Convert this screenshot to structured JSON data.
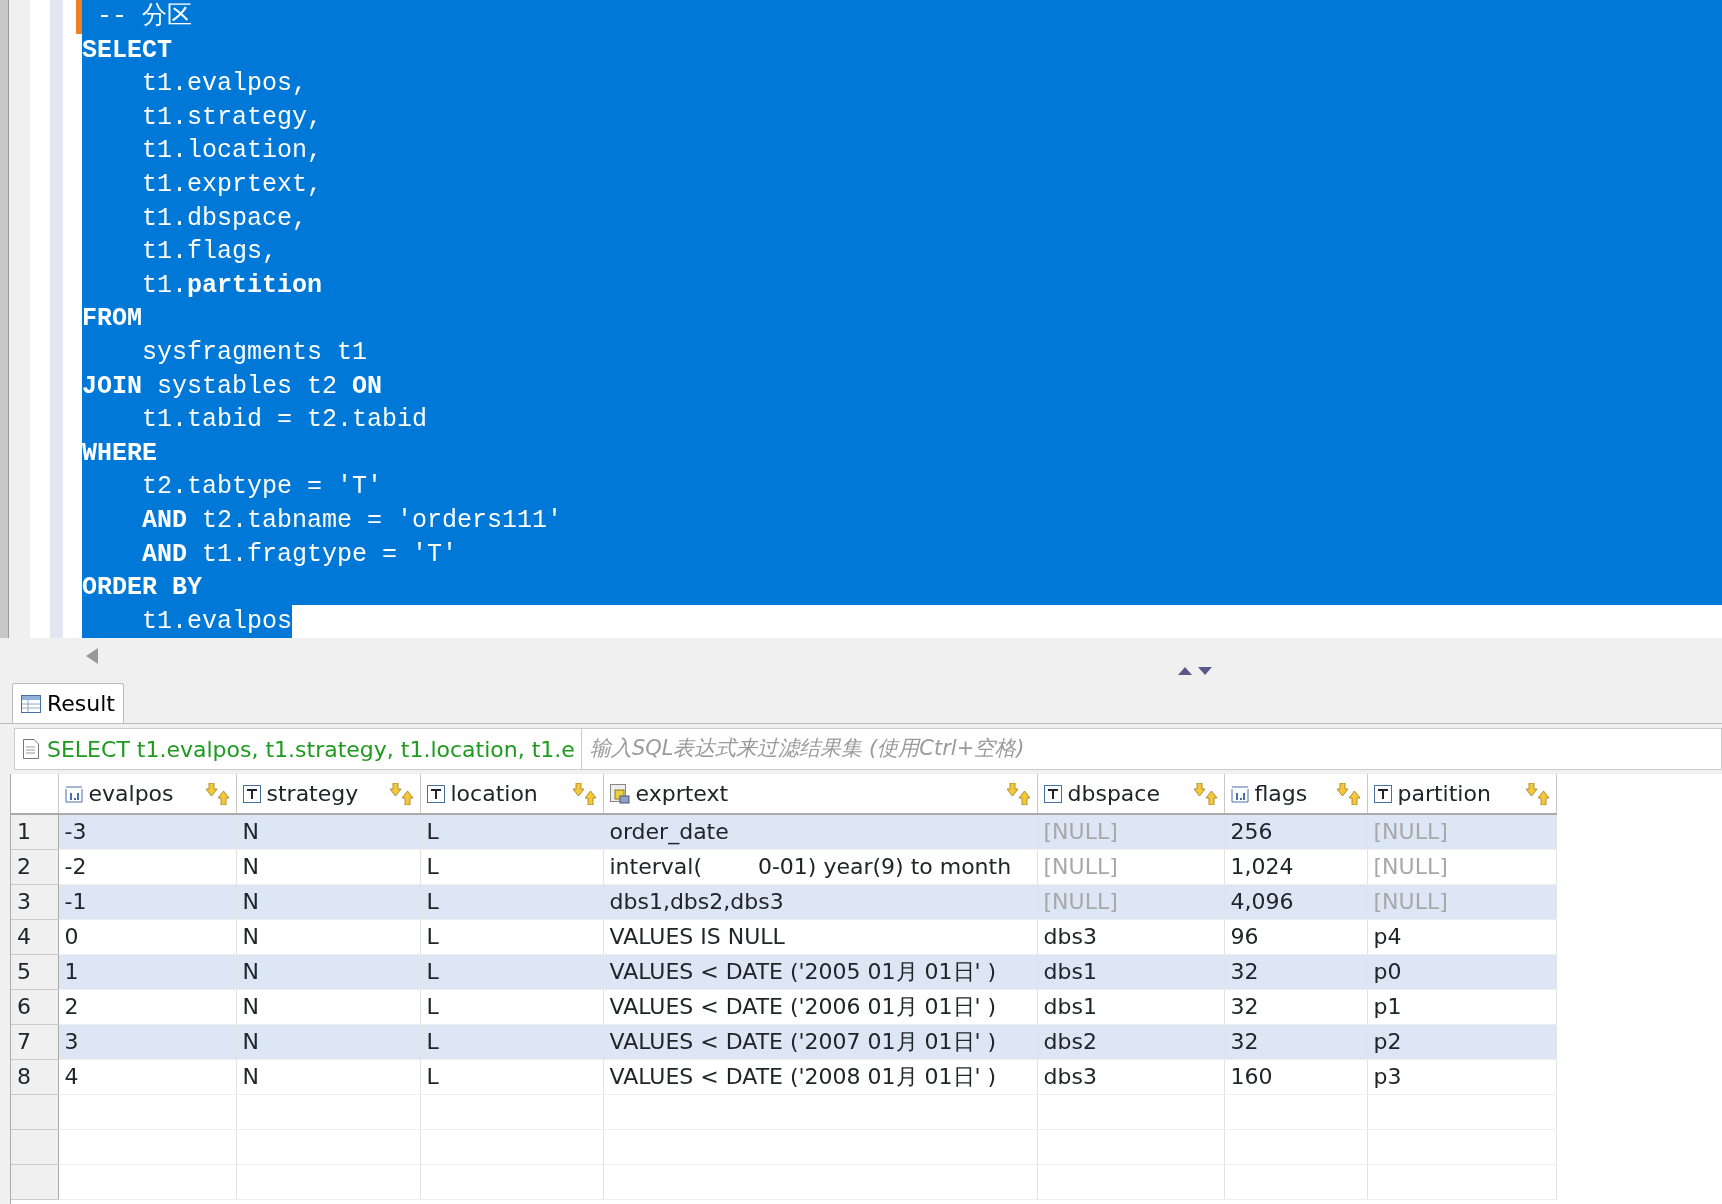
{
  "editor": {
    "lines": [
      {
        "text": " -- 分区",
        "selected": true,
        "current": true
      },
      {
        "text": "**SELECT**",
        "selected": true,
        "current": false
      },
      {
        "text": "    t1.evalpos,",
        "selected": true,
        "current": false
      },
      {
        "text": "    t1.strategy,",
        "selected": true,
        "current": false
      },
      {
        "text": "    t1.location,",
        "selected": true,
        "current": false
      },
      {
        "text": "    t1.exprtext,",
        "selected": true,
        "current": false
      },
      {
        "text": "    t1.dbspace,",
        "selected": true,
        "current": false
      },
      {
        "text": "    t1.flags,",
        "selected": true,
        "current": false
      },
      {
        "text": "    t1.**partition**",
        "selected": true,
        "current": false
      },
      {
        "text": "**FROM**",
        "selected": true,
        "current": false
      },
      {
        "text": "    sysfragments t1",
        "selected": true,
        "current": false
      },
      {
        "text": "**JOIN** systables t2 **ON**",
        "selected": true,
        "current": false
      },
      {
        "text": "    t1.tabid = t2.tabid",
        "selected": true,
        "current": false
      },
      {
        "text": "**WHERE**",
        "selected": true,
        "current": false
      },
      {
        "text": "    t2.tabtype = 'T'",
        "selected": true,
        "current": false
      },
      {
        "text": "    **AND** t2.tabname = 'orders111'",
        "selected": true,
        "current": false
      },
      {
        "text": "    **AND** t1.fragtype = 'T'",
        "selected": true,
        "current": false
      },
      {
        "text": "**ORDER BY**",
        "selected": true,
        "current": false
      },
      {
        "text": "    t1.evalpos",
        "selected": true,
        "current": false
      }
    ]
  },
  "result_tab": {
    "label": "Result",
    "selected": true
  },
  "filter": {
    "query": "SELECT t1.evalpos, t1.strategy, t1.location, t1.e",
    "placeholder": "输入SQL表达式来过滤结果集 (使用Ctrl+空格)"
  },
  "table": {
    "columns": [
      {
        "name": "evalpos",
        "kind": "number"
      },
      {
        "name": "strategy",
        "kind": "text"
      },
      {
        "name": "location",
        "kind": "text"
      },
      {
        "name": "exprtext",
        "kind": "expr"
      },
      {
        "name": "dbspace",
        "kind": "text"
      },
      {
        "name": "flags",
        "kind": "number"
      },
      {
        "name": "partition",
        "kind": "text"
      }
    ],
    "rows": [
      {
        "number": "1",
        "cells": [
          {
            "value": "-3",
            "null": false
          },
          {
            "value": "N",
            "null": false
          },
          {
            "value": "L",
            "null": false
          },
          {
            "value": "order_date",
            "null": false
          },
          {
            "value": "[NULL]",
            "null": true
          },
          {
            "value": "256",
            "null": false
          },
          {
            "value": "[NULL]",
            "null": true
          }
        ]
      },
      {
        "number": "2",
        "cells": [
          {
            "value": "-2",
            "null": false
          },
          {
            "value": "N",
            "null": false
          },
          {
            "value": "L",
            "null": false
          },
          {
            "value": "interval(        0-01) year(9) to month",
            "null": false
          },
          {
            "value": "[NULL]",
            "null": true
          },
          {
            "value": "1,024",
            "null": false
          },
          {
            "value": "[NULL]",
            "null": true
          }
        ]
      },
      {
        "number": "3",
        "cells": [
          {
            "value": "-1",
            "null": false
          },
          {
            "value": "N",
            "null": false
          },
          {
            "value": "L",
            "null": false
          },
          {
            "value": "dbs1,dbs2,dbs3",
            "null": false
          },
          {
            "value": "[NULL]",
            "null": true
          },
          {
            "value": "4,096",
            "null": false
          },
          {
            "value": "[NULL]",
            "null": true
          }
        ]
      },
      {
        "number": "4",
        "cells": [
          {
            "value": "0",
            "null": false
          },
          {
            "value": "N",
            "null": false
          },
          {
            "value": "L",
            "null": false
          },
          {
            "value": "VALUES IS NULL",
            "null": false
          },
          {
            "value": "dbs3",
            "null": false
          },
          {
            "value": "96",
            "null": false
          },
          {
            "value": "p4",
            "null": false
          }
        ]
      },
      {
        "number": "5",
        "cells": [
          {
            "value": "1",
            "null": false
          },
          {
            "value": "N",
            "null": false
          },
          {
            "value": "L",
            "null": false
          },
          {
            "value": "VALUES < DATE ('2005 01月 01日' )",
            "null": false
          },
          {
            "value": "dbs1",
            "null": false
          },
          {
            "value": "32",
            "null": false
          },
          {
            "value": "p0",
            "null": false
          }
        ]
      },
      {
        "number": "6",
        "cells": [
          {
            "value": "2",
            "null": false
          },
          {
            "value": "N",
            "null": false
          },
          {
            "value": "L",
            "null": false
          },
          {
            "value": "VALUES < DATE ('2006 01月 01日' )",
            "null": false
          },
          {
            "value": "dbs1",
            "null": false
          },
          {
            "value": "32",
            "null": false
          },
          {
            "value": "p1",
            "null": false
          }
        ]
      },
      {
        "number": "7",
        "cells": [
          {
            "value": "3",
            "null": false
          },
          {
            "value": "N",
            "null": false
          },
          {
            "value": "L",
            "null": false
          },
          {
            "value": "VALUES < DATE ('2007 01月 01日' )",
            "null": false
          },
          {
            "value": "dbs2",
            "null": false
          },
          {
            "value": "32",
            "null": false
          },
          {
            "value": "p2",
            "null": false
          }
        ]
      },
      {
        "number": "8",
        "cells": [
          {
            "value": "4",
            "null": false
          },
          {
            "value": "N",
            "null": false
          },
          {
            "value": "L",
            "null": false
          },
          {
            "value": "VALUES < DATE ('2008 01月 01日' )",
            "null": false
          },
          {
            "value": "dbs3",
            "null": false
          },
          {
            "value": "160",
            "null": false
          },
          {
            "value": "p3",
            "null": false
          }
        ]
      }
    ]
  }
}
